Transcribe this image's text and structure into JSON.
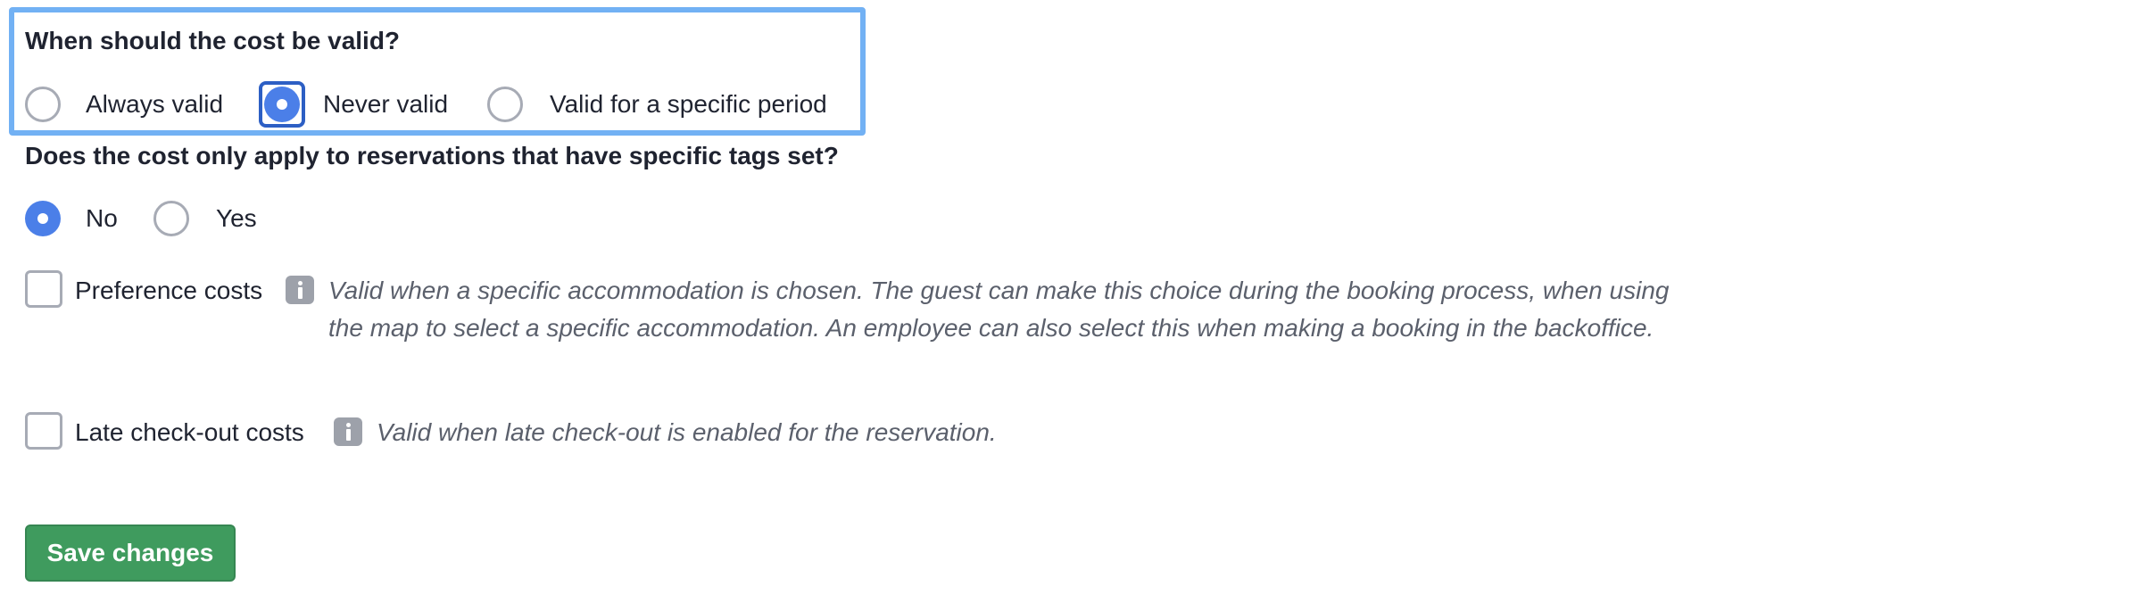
{
  "validity": {
    "question": "When should the cost be valid?",
    "options": [
      {
        "label": "Always valid",
        "checked": false
      },
      {
        "label": "Never valid",
        "checked": true
      },
      {
        "label": "Valid for a specific period",
        "checked": false
      }
    ]
  },
  "tags": {
    "question": "Does the cost only apply to reservations that have specific tags set?",
    "options": [
      {
        "label": "No",
        "checked": true
      },
      {
        "label": "Yes",
        "checked": false
      }
    ]
  },
  "extras": [
    {
      "label": "Preference costs",
      "checked": false,
      "icon": "info-icon",
      "description": "Valid when a specific accommodation is chosen. The guest can make this choice during the booking process, when using the map to select a specific accommodation. An employee can also select this when making a booking in the backoffice."
    },
    {
      "label": "Late check-out costs",
      "checked": false,
      "icon": "info-icon",
      "description": "Valid when late check-out is enabled for the reservation."
    }
  ],
  "save_label": "Save changes",
  "colors": {
    "accent": "#4b7fe8",
    "focus": "#72b1f4",
    "save": "#3f9b5e"
  }
}
